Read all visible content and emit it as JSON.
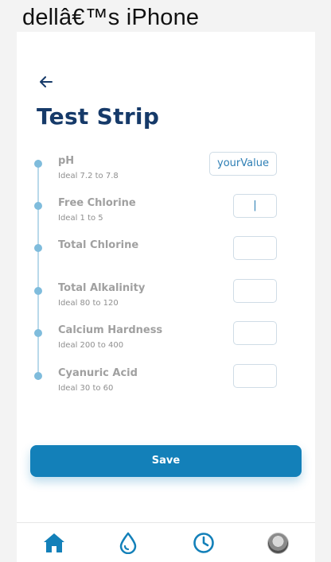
{
  "device_title": "dellâ€™s iPhone",
  "page": {
    "title": "Test Strip"
  },
  "readings": [
    {
      "label": "pH",
      "ideal": "Ideal 7.2 to 7.8",
      "value": "yourValue"
    },
    {
      "label": "Free Chlorine",
      "ideal": "Ideal 1 to 5",
      "value": "|"
    },
    {
      "label": "Total Chlorine",
      "ideal": "",
      "value": ""
    },
    {
      "label": "Total Alkalinity",
      "ideal": "Ideal 80 to 120",
      "value": ""
    },
    {
      "label": "Calcium Hardness",
      "ideal": "Ideal 200 to 400",
      "value": ""
    },
    {
      "label": "Cyanuric Acid",
      "ideal": "Ideal 30 to 60",
      "value": ""
    }
  ],
  "save_label": "Save",
  "nav": {
    "items": [
      "home-icon",
      "water-drop-icon",
      "clock-icon",
      "avatar"
    ]
  },
  "colors": {
    "title": "#163a69",
    "accent": "#1380b9",
    "timeline_dot": "#7fbcdc",
    "label": "#a0a0a0"
  }
}
